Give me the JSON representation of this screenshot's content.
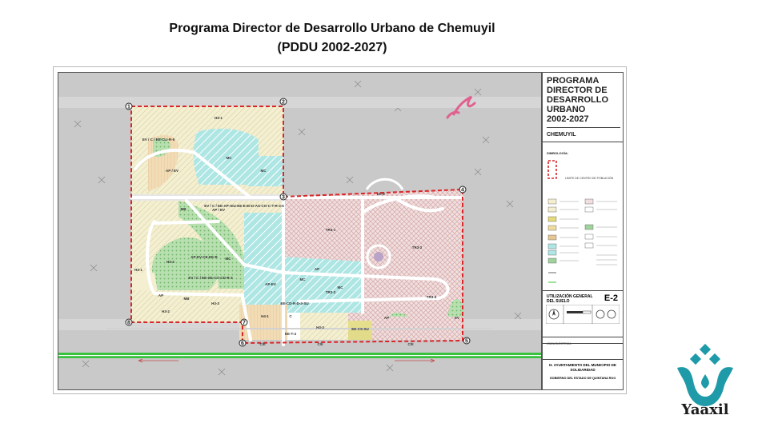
{
  "header": {
    "title_line1": "Programa Director de Desarrollo Urbano de Chemuyil",
    "title_line2": "(PDDU 2002-2027)"
  },
  "legend": {
    "plan_title": "PROGRAMA DIRECTOR DE DESARROLLO URBANO 2002-2027",
    "plan_title_lines": [
      "PROGRAMA",
      "DIRECTOR DE",
      "DESARROLLO",
      "URBANO",
      "2002-2027"
    ],
    "place": "CHEMUYIL",
    "simbologia": "SIMBOLOGÍA:",
    "limite": "LIMITE DE CENTRO DE POBLACIÓN",
    "sheet_title": "UTILIZACIÓN GENERAL DEL SUELO",
    "sheet_code": "E-2",
    "municipality": "H. AYUNTAMIENTO DEL MUNICIPIO DE SOLIDARIDAD",
    "government": "GOBIERNO DEL ESTADO DE QUINTANA ROO",
    "elt": "LÍNEA ELÉCTRICA",
    "colors": {
      "urban_res": "#f3efd0",
      "tourist": "#f1dede",
      "equipment": "#aee6e4",
      "green": "#9fd39c",
      "boundary": "#d9262a",
      "highway": "#39c23f"
    }
  },
  "map": {
    "vertices": [
      "1",
      "2",
      "3",
      "4",
      "5",
      "6",
      "7",
      "8"
    ],
    "zones": {
      "h3_1": "H3-1",
      "h3_1b": "H3-1",
      "h3_2": "H3-2",
      "h3_2b": "H3-2",
      "h3_3": "H3-3",
      "h4_1": "H4-1",
      "tr3_1": "TR3-1",
      "tr3_2": "TR3-2",
      "tr3_2b": "TR3-2",
      "tr3_4": "TR3-4",
      "mc1": "MC",
      "mc2": "MC",
      "mc3": "MC",
      "mc4": "MC",
      "mc5": "MC",
      "ap_ev": "AP / EV",
      "ap_ev2": "AP / EV",
      "ap1": "AP",
      "ap2": "AP",
      "ap3": "AP",
      "ev": "EV",
      "ev_c": "EV / C / EE-CLI-R-5",
      "ev_c2": "EV / C / EE-AP-SIU-EE-E-EI-D-AS-CO-C-T-R-3-5",
      "ev_c3": "EV / C / EE-SE-CO-CD-R-3",
      "ap_ev_ce": "AP-EV-CE-EE-R",
      "ee_cd": "EE-CD-R-D-3-SU",
      "ee_t4": "EE-T-4",
      "ce_e": "EE-E",
      "ee_cs": "EE-CS-SU",
      "c_lbl": "C",
      "cr1": "C/II",
      "cr2": "C/II",
      "cr3": "C/II",
      "mb1": "MB",
      "mb2": "MB",
      "am_ev": "AP-EV"
    }
  },
  "brand": {
    "name": "Yaaxil"
  }
}
